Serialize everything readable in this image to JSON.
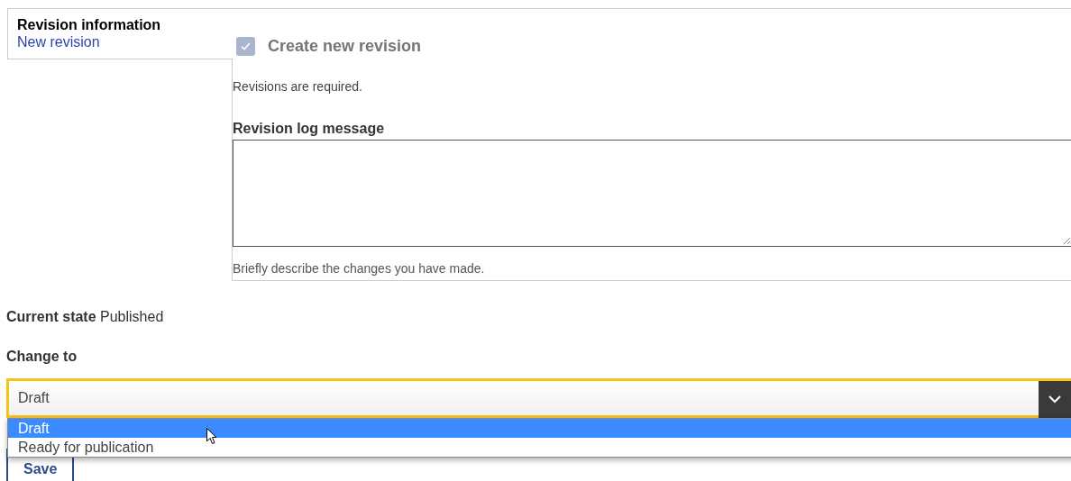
{
  "vertical_tabs": [
    {
      "title": "Revision information",
      "summary": "New revision",
      "selected": true
    }
  ],
  "revision": {
    "checkbox": {
      "label": "Create new revision",
      "checked": true,
      "disabled": true
    },
    "description": "Revisions are required.",
    "log_message": {
      "label": "Revision log message",
      "hint": "Briefly describe the changes you have made."
    }
  },
  "current_state": {
    "label": "Current state",
    "value": "Published"
  },
  "change_to": {
    "label": "Change to",
    "value": "Draft",
    "expanded": true,
    "options": [
      {
        "label": "Draft",
        "selected": true
      },
      {
        "label": "Ready for publication",
        "selected": false
      }
    ]
  },
  "save_button": "Save"
}
